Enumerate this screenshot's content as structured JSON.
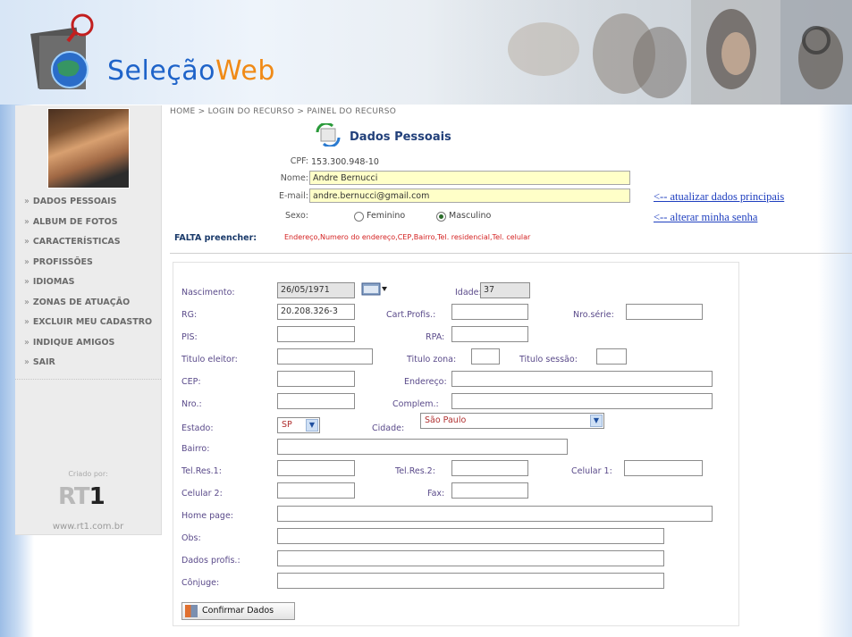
{
  "brand": {
    "name_part1": "Seleção",
    "name_part2": "Web"
  },
  "breadcrumb": "HOME > LOGIN DO RECURSO > PAINEL DO RECURSO",
  "sidebar": {
    "items": [
      {
        "label": "DADOS PESSOAIS"
      },
      {
        "label": "ALBUM DE FOTOS"
      },
      {
        "label": "CARACTERÍSTICAS"
      },
      {
        "label": "PROFISSÕES"
      },
      {
        "label": "IDIOMAS"
      },
      {
        "label": "ZONAS DE ATUAÇÃO"
      },
      {
        "label": "EXCLUIR MEU CADASTRO"
      },
      {
        "label": "INDIQUE AMIGOS"
      },
      {
        "label": "SAIR"
      }
    ],
    "arrow": "»",
    "created_by": "Criado por:",
    "brand_rt": "RT",
    "brand_one": "1",
    "site": "www.rt1.com.br"
  },
  "personal": {
    "title": "Dados Pessoais",
    "cpf_label": "CPF:",
    "cpf_value": "153.300.948-10",
    "nome_label": "Nome:",
    "nome_value": "Andre Bernucci",
    "email_label": "E-mail:",
    "email_value": "andre.bernucci@gmail.com",
    "sexo_label": "Sexo:",
    "sexo_feminino": "Feminino",
    "sexo_masculino": "Masculino",
    "sexo_selected": "Masculino",
    "link_update": "<-- atualizar dados principais",
    "link_password": "<-- alterar minha senha",
    "falta_label": "FALTA preencher:",
    "falta_list": "Endereço,Numero do endereço,CEP,Bairro,Tel. residencial,Tel. celular"
  },
  "form": {
    "nascimento_label": "Nascimento:",
    "nascimento_value": "26/05/1971",
    "idade_label": "Idade:",
    "idade_value": "37",
    "rg_label": "RG:",
    "rg_value": "20.208.326-3",
    "cart_label": "Cart.Profis.:",
    "nro_serie_label": "Nro.série:",
    "pis_label": "PIS:",
    "rpa_label": "RPA:",
    "titulo_label": "Titulo eleitor:",
    "titulo_zona_label": "Titulo zona:",
    "titulo_secao_label": "Titulo sessão:",
    "cep_label": "CEP:",
    "endereco_label": "Endereço:",
    "nro_label": "Nro.:",
    "complem_label": "Complem.:",
    "estado_label": "Estado:",
    "estado_value": "SP",
    "cidade_label": "Cidade:",
    "cidade_value": "São Paulo",
    "bairro_label": "Bairro:",
    "telres1_label": "Tel.Res.1:",
    "telres2_label": "Tel.Res.2:",
    "celular1_label": "Celular 1:",
    "celular2_label": "Celular 2:",
    "fax_label": "Fax:",
    "homepage_label": "Home page:",
    "obs_label": "Obs:",
    "dados_profis_label": "Dados profis.:",
    "conjuge_label": "Cônjuge:",
    "confirm_button": "Confirmar Dados"
  }
}
